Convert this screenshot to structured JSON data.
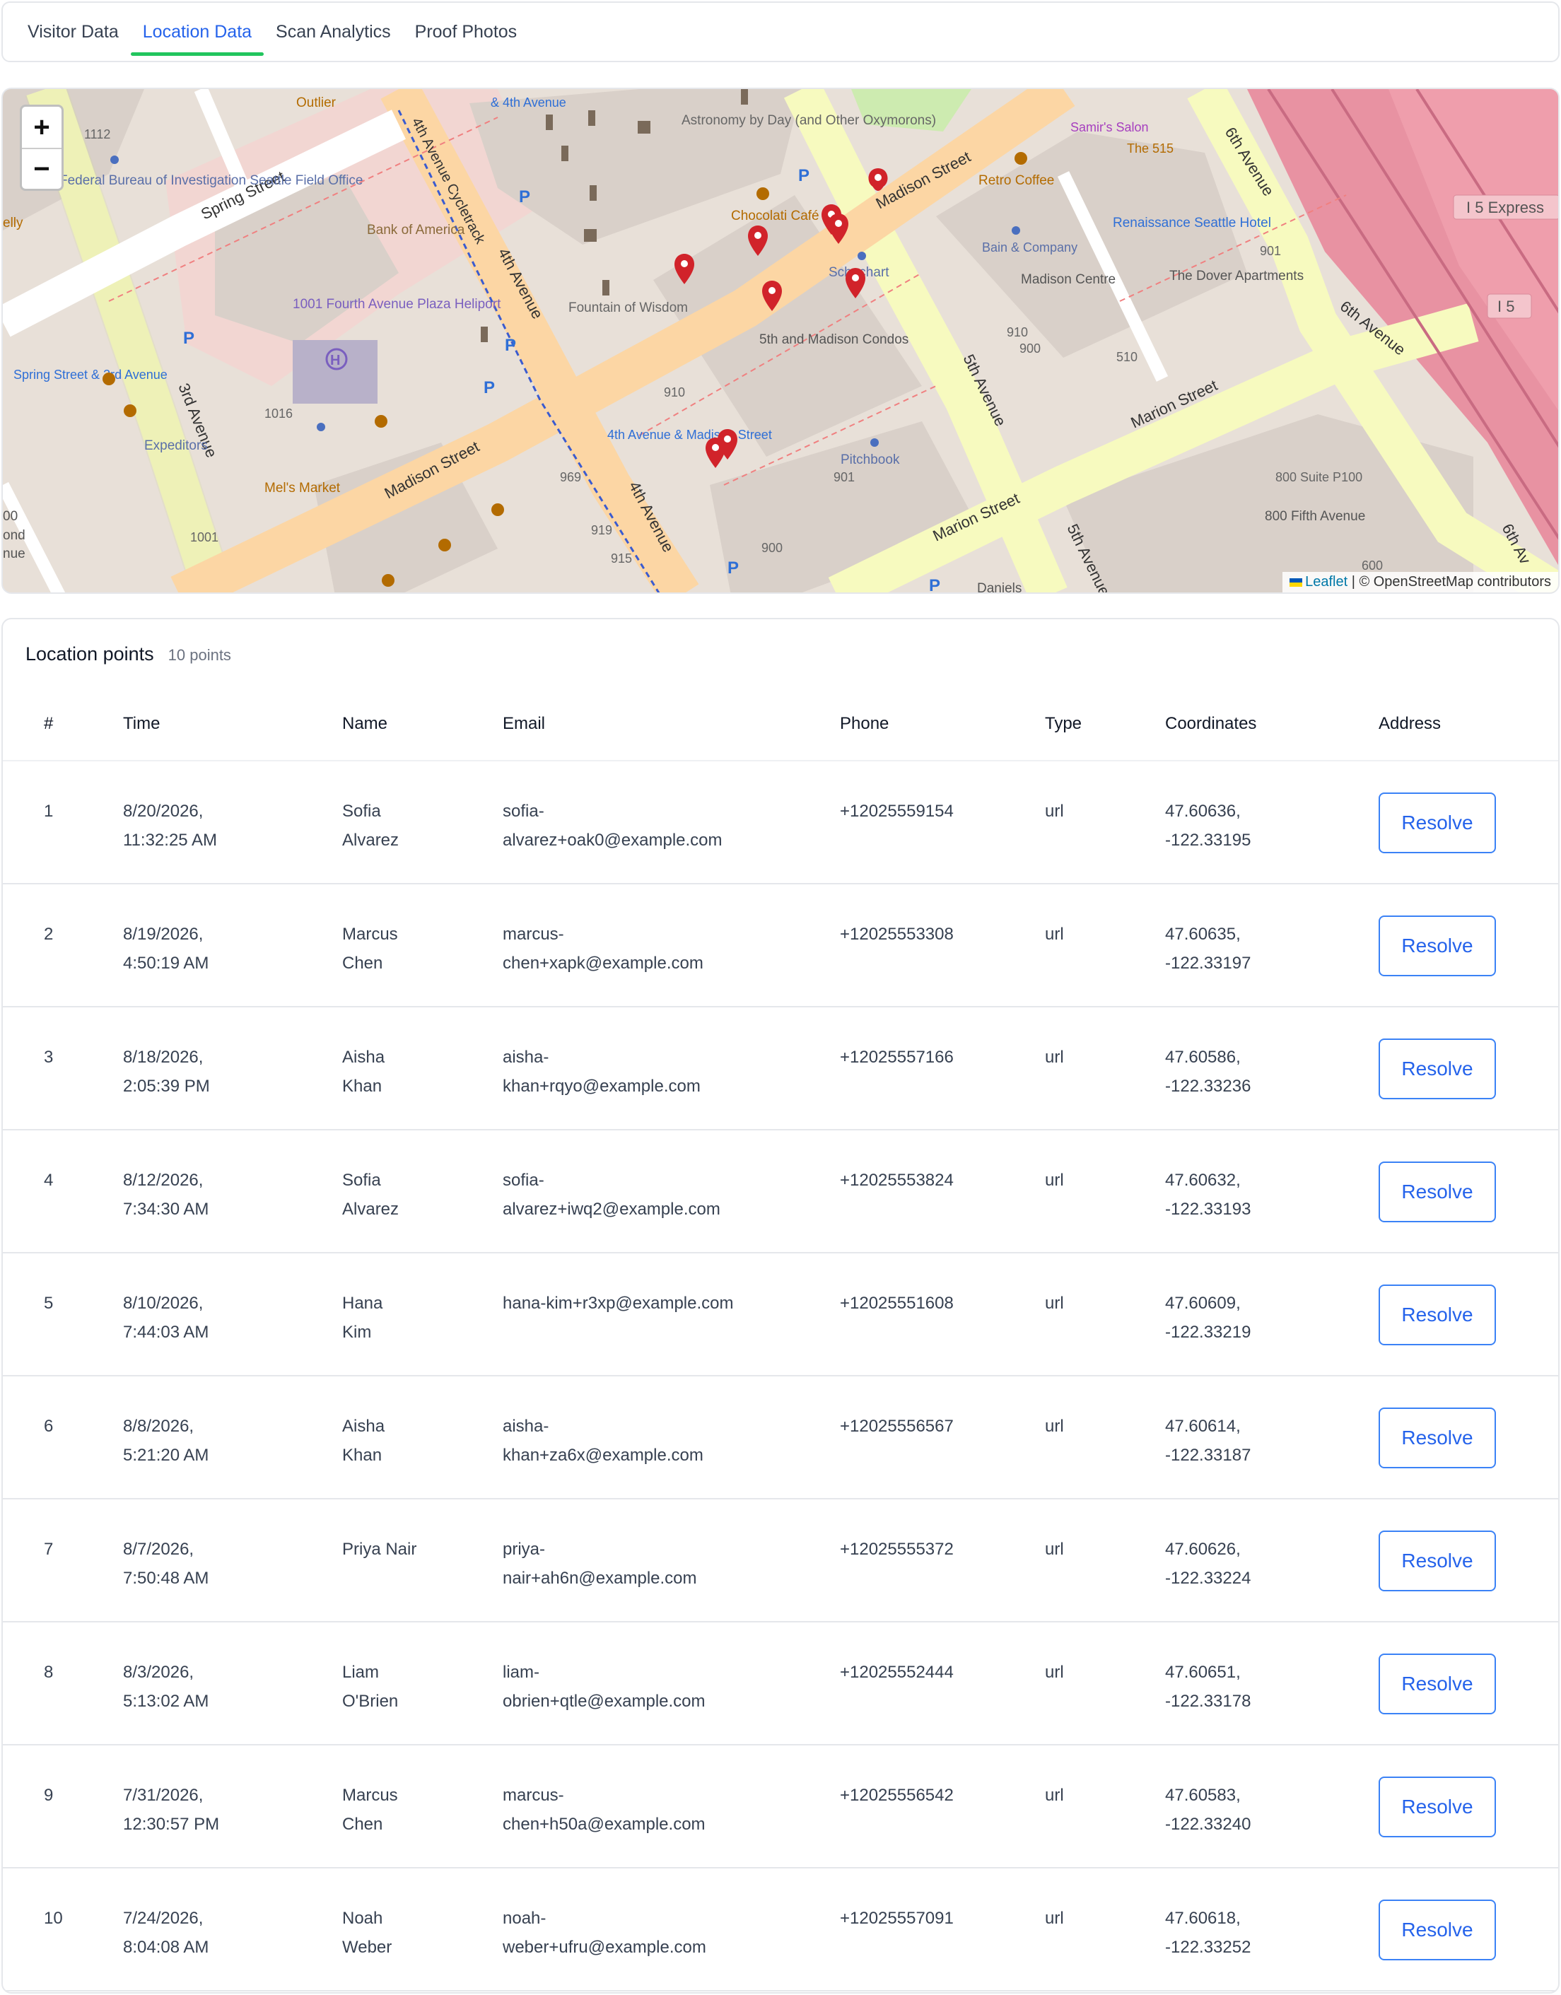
{
  "tabs": [
    {
      "label": "Visitor Data",
      "active": false
    },
    {
      "label": "Location Data",
      "active": true
    },
    {
      "label": "Scan Analytics",
      "active": false
    },
    {
      "label": "Proof Photos",
      "active": false
    }
  ],
  "map": {
    "zoom_in": "+",
    "zoom_out": "−",
    "attribution_link": "Leaflet",
    "attribution_text": "| © OpenStreetMap contributors",
    "labels": {
      "spring_street": "Spring Street",
      "madison_street_1": "Madison Street",
      "madison_street_2": "Madison Street",
      "marion_street_1": "Marion Street",
      "marion_street_2": "Marion Street",
      "fourth_avenue": "4th Avenue",
      "fourth_avenue_2": "4th Avenue",
      "fourth_avenue_cycletrack": "4th Avenue Cycletrack",
      "third_avenue": "3rd Avenue",
      "fifth_avenue": "5th Avenue",
      "fifth_avenue_2": "5th Avenue",
      "sixth_avenue": "6th Avenue",
      "sixth_avenue_2": "6th Avenue",
      "sixth_avenue_3": "6th Av",
      "i5_express": "I 5 Express",
      "i5": "I 5",
      "fbi": "Federal Bureau of Investigation Seattle Field Office",
      "bank_of_america": "Bank of America",
      "heliport": "1001 Fourth Avenue Plaza Heliport",
      "fountain": "Fountain of Wisdom",
      "astronomy": "Astronomy by Day (and Other Oxymorons)",
      "chocolati": "Chocolati Café",
      "condos": "5th and Madison Condos",
      "schuchart": "Schuchart",
      "retro_coffee": "Retro Coffee",
      "bain": "Bain & Company",
      "madison_centre": "Madison Centre",
      "renaissance": "Renaissance Seattle Hotel",
      "dover": "The Dover Apartments",
      "samirs": "Samir's Salon",
      "the515": "The 515",
      "pitchbook": "Pitchbook",
      "stop_madison": "4th Avenue & Madison Street",
      "stop_spring": "Spring Street & 3rd Avenue",
      "expeditors": "Expeditors",
      "mels": "Mel's Market",
      "suite800": "800 Suite P100",
      "fifth800": "800 Fifth Avenue",
      "outlier": "Outlier",
      "stop_4th": "& 4th Avenue",
      "daniels": "Daniels",
      "n1112": "1112",
      "n1016": "1016",
      "n1001": "1001",
      "n969": "969",
      "n919": "919",
      "n915": "915",
      "n900": "900",
      "n901": "901",
      "n910": "910",
      "n910b": "910",
      "n900b": "900",
      "n510": "510",
      "n901b": "901",
      "n600": "600",
      "n00": "00",
      "ond": "ond",
      "nue": "nue",
      "elly": "elly"
    }
  },
  "location_panel": {
    "title": "Location points",
    "count": "10 points",
    "columns": [
      "#",
      "Time",
      "Name",
      "Email",
      "Phone",
      "Type",
      "Coordinates",
      "Address"
    ],
    "resolve_label": "Resolve",
    "rows": [
      {
        "n": "1",
        "date": "8/20/2026,",
        "time": "11:32:25 AM",
        "first": "Sofia",
        "last": "Alvarez",
        "email1": "sofia-",
        "email2": "alvarez+oak0@example.com",
        "phone": "+12025559154",
        "type": "url",
        "lat": "47.60636,",
        "lng": "-122.33195"
      },
      {
        "n": "2",
        "date": "8/19/2026,",
        "time": "4:50:19 AM",
        "first": "Marcus",
        "last": "Chen",
        "email1": "marcus-",
        "email2": "chen+xapk@example.com",
        "phone": "+12025553308",
        "type": "url",
        "lat": "47.60635,",
        "lng": "-122.33197"
      },
      {
        "n": "3",
        "date": "8/18/2026,",
        "time": "2:05:39 PM",
        "first": "Aisha",
        "last": "Khan",
        "email1": "aisha-",
        "email2": "khan+rqyo@example.com",
        "phone": "+12025557166",
        "type": "url",
        "lat": "47.60586,",
        "lng": "-122.33236"
      },
      {
        "n": "4",
        "date": "8/12/2026,",
        "time": "7:34:30 AM",
        "first": "Sofia",
        "last": "Alvarez",
        "email1": "sofia-",
        "email2": "alvarez+iwq2@example.com",
        "phone": "+12025553824",
        "type": "url",
        "lat": "47.60632,",
        "lng": "-122.33193"
      },
      {
        "n": "5",
        "date": "8/10/2026,",
        "time": "7:44:03 AM",
        "first": "Hana",
        "last": "Kim",
        "email1": "hana-kim+r3xp@example.com",
        "email2": "",
        "phone": "+12025551608",
        "type": "url",
        "lat": "47.60609,",
        "lng": "-122.33219"
      },
      {
        "n": "6",
        "date": "8/8/2026,",
        "time": "5:21:20 AM",
        "first": "Aisha",
        "last": "Khan",
        "email1": "aisha-",
        "email2": "khan+za6x@example.com",
        "phone": "+12025556567",
        "type": "url",
        "lat": "47.60614,",
        "lng": "-122.33187"
      },
      {
        "n": "7",
        "date": "8/7/2026,",
        "time": "7:50:48 AM",
        "first": "Priya Nair",
        "last": "",
        "email1": "priya-",
        "email2": "nair+ah6n@example.com",
        "phone": "+12025555372",
        "type": "url",
        "lat": "47.60626,",
        "lng": "-122.33224"
      },
      {
        "n": "8",
        "date": "8/3/2026,",
        "time": "5:13:02 AM",
        "first": "Liam",
        "last": "O'Brien",
        "email1": "liam-",
        "email2": "obrien+qtle@example.com",
        "phone": "+12025552444",
        "type": "url",
        "lat": "47.60651,",
        "lng": "-122.33178"
      },
      {
        "n": "9",
        "date": "7/31/2026,",
        "time": "12:30:57 PM",
        "first": "Marcus",
        "last": "Chen",
        "email1": "marcus-",
        "email2": "chen+h50a@example.com",
        "phone": "+12025556542",
        "type": "url",
        "lat": "47.60583,",
        "lng": "-122.33240"
      },
      {
        "n": "10",
        "date": "7/24/2026,",
        "time": "8:04:08 AM",
        "first": "Noah",
        "last": "Weber",
        "email1": "noah-",
        "email2": "weber+ufru@example.com",
        "phone": "+12025557091",
        "type": "url",
        "lat": "47.60618,",
        "lng": "-122.33252"
      }
    ]
  }
}
